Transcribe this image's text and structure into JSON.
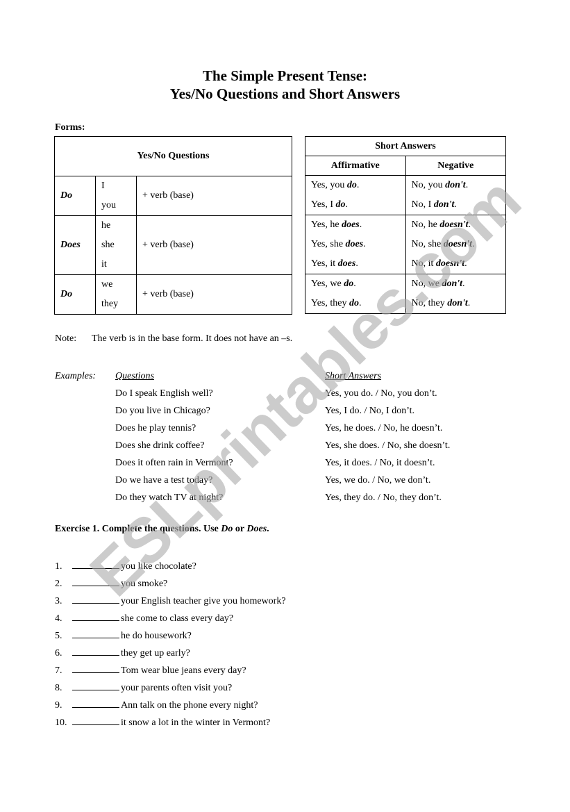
{
  "title": {
    "line1": "The Simple Present Tense:",
    "line2": "Yes/No Questions and Short Answers"
  },
  "forms_label": "Forms:",
  "yes_no_table": {
    "header": "Yes/No Questions",
    "rows": [
      {
        "aux": "Do",
        "subjects": [
          "I",
          "you"
        ],
        "verb": "+ verb (base)"
      },
      {
        "aux": "Does",
        "subjects": [
          "he",
          "she",
          "it"
        ],
        "verb": "+ verb (base)"
      },
      {
        "aux": "Do",
        "subjects": [
          "we",
          "they"
        ],
        "verb": "+ verb (base)"
      }
    ]
  },
  "short_answers_table": {
    "header": "Short Answers",
    "col_affirmative": "Affirmative",
    "col_negative": "Negative",
    "groups": [
      {
        "affirmative": [
          {
            "pre": "Yes, you ",
            "em": "do",
            "post": "."
          },
          {
            "pre": "Yes, I ",
            "em": "do",
            "post": "."
          }
        ],
        "negative": [
          {
            "pre": "No, you ",
            "em": "don't",
            "post": "."
          },
          {
            "pre": "No, I ",
            "em": "don't",
            "post": "."
          }
        ]
      },
      {
        "affirmative": [
          {
            "pre": "Yes, he ",
            "em": "does",
            "post": "."
          },
          {
            "pre": "Yes, she ",
            "em": "does",
            "post": "."
          },
          {
            "pre": "Yes, it ",
            "em": "does",
            "post": "."
          }
        ],
        "negative": [
          {
            "pre": "No, he ",
            "em": "doesn't",
            "post": "."
          },
          {
            "pre": "No, she ",
            "em": "doesn't",
            "post": "."
          },
          {
            "pre": "No, it ",
            "em": "doesn't",
            "post": "."
          }
        ]
      },
      {
        "affirmative": [
          {
            "pre": "Yes, we ",
            "em": "do",
            "post": "."
          },
          {
            "pre": "Yes, they ",
            "em": "do",
            "post": "."
          }
        ],
        "negative": [
          {
            "pre": "No, we ",
            "em": "don't",
            "post": "."
          },
          {
            "pre": "No, they ",
            "em": "don't",
            "post": "."
          }
        ]
      }
    ]
  },
  "note": {
    "label": "Note:",
    "text": "The verb is in the base form. It does not have an –s."
  },
  "examples": {
    "label": "Examples:",
    "questions_header": "Questions",
    "answers_header": "Short Answers",
    "questions": [
      "Do I speak English well?",
      "Do you live in Chicago?",
      "Does he play tennis?",
      "Does she drink coffee?",
      "Does it often rain in Vermont?",
      "Do we have a test today?",
      "Do they watch TV at night?"
    ],
    "answers": [
      "Yes, you do. / No, you don’t.",
      "Yes, I do. / No, I don’t.",
      "Yes, he does. / No, he doesn’t.",
      "Yes, she does. / No, she doesn’t.",
      "Yes, it does. / No, it doesn’t.",
      "Yes, we do. / No, we don’t.",
      "Yes, they do. / No, they don’t."
    ]
  },
  "exercise": {
    "title_pre": "Exercise 1. Complete the questions. Use ",
    "title_do": "Do",
    "title_mid": " or ",
    "title_does": "Does",
    "title_post": ".",
    "items": [
      {
        "num": "1.",
        "text": "you like chocolate?"
      },
      {
        "num": "2.",
        "text": "you smoke?"
      },
      {
        "num": "3.",
        "text": "your English teacher give you homework?"
      },
      {
        "num": "4.",
        "text": "she come to class every day?"
      },
      {
        "num": "5.",
        "text": "he do housework?"
      },
      {
        "num": "6.",
        "text": "they get up early?"
      },
      {
        "num": "7.",
        "text": "Tom wear blue jeans every day?"
      },
      {
        "num": "8.",
        "text": "your parents often visit you?"
      },
      {
        "num": "9.",
        "text": "Ann talk on the phone every night?"
      },
      {
        "num": "10.",
        "text": "it snow a lot in the winter in Vermont?"
      }
    ]
  },
  "watermark": "ESLprintables.com"
}
